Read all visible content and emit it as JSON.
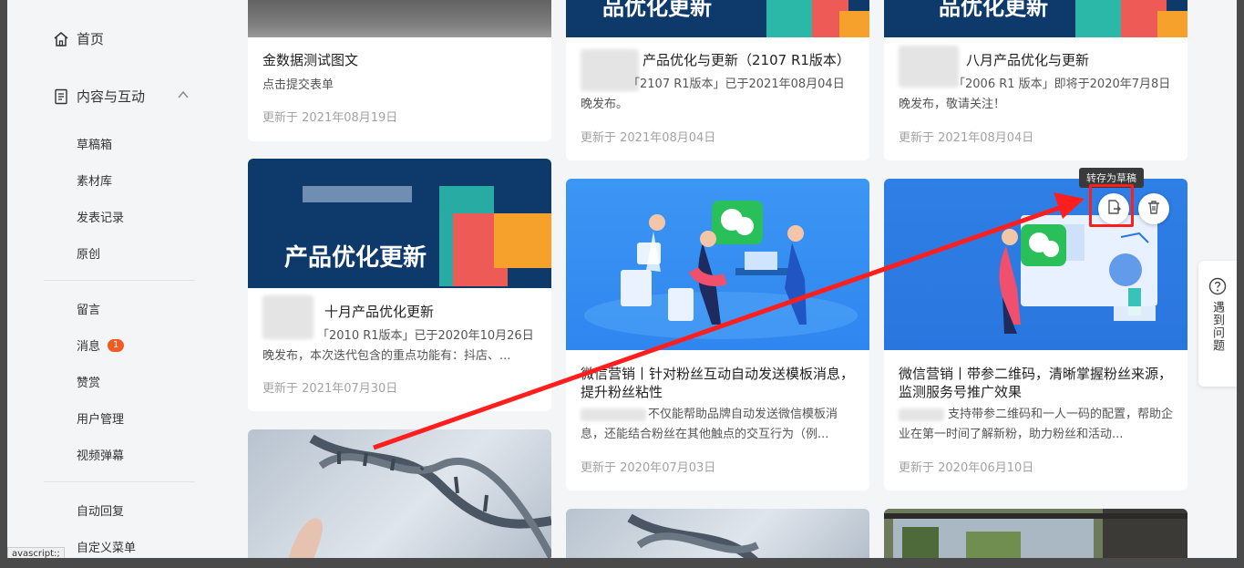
{
  "sidebar": {
    "home_label": "首页",
    "section_label": "内容与互动",
    "items": [
      {
        "label": "草稿箱"
      },
      {
        "label": "素材库"
      },
      {
        "label": "发表记录"
      },
      {
        "label": "原创"
      },
      {
        "label": "留言"
      },
      {
        "label": "消息",
        "badge": "1"
      },
      {
        "label": "赞赏"
      },
      {
        "label": "用户管理"
      },
      {
        "label": "视频弹幕"
      },
      {
        "label": "自动回复"
      },
      {
        "label": "自定义菜单"
      }
    ],
    "status_tip": "avascript:;"
  },
  "cards": [
    {
      "title": "金数据测试图文",
      "desc": "点击提交表单",
      "date": "更新于 2021年08月19日"
    },
    {
      "banner": "产品优化更新",
      "title": "十月产品优化更新",
      "desc": "「2010 R1版本」已于2020年10月26日晚发布，本次迭代包含的重点功能有：抖店、...",
      "date": "更新于 2021年07月30日"
    },
    {
      "title": "产品优化与更新（2107 R1版本）",
      "desc": "「2107 R1版本」已于2021年08月04日晚发布。",
      "date": "更新于 2021年08月04日"
    },
    {
      "title": "微信营销丨针对粉丝互动自动发送模板消息，提升粉丝粘性",
      "desc": "不仅能帮助品牌自动发送微信模板消息，还能结合粉丝在其他触点的交互行为（例...",
      "date": "更新于 2020年07月03日"
    },
    {
      "title": "八月产品优化与更新",
      "desc": "「2006 R1 版本」即将于2020年7月8日晚发布，敬请关注！",
      "date": "更新于 2021年08月04日"
    },
    {
      "title": "微信营销丨带参二维码，清晰掌握粉丝来源，监测服务号推广效果",
      "desc": "支持带参二维码和一人一码的配置，帮助企业在第一时间了解新粉，助力粉丝和活动...",
      "date": "更新于 2020年06月10日"
    }
  ],
  "top_banner": {
    "text": "品优化更新"
  },
  "top_banner2": {
    "text": "品优化更新"
  },
  "tooltip": "转存为草稿",
  "help": {
    "label": "遇到问题"
  },
  "colors": {
    "accent_red": "#ff1e1e",
    "badge": "#f05a24",
    "banner_navy": "#0d3a6b",
    "illustration_blue": "#2f86f0"
  }
}
